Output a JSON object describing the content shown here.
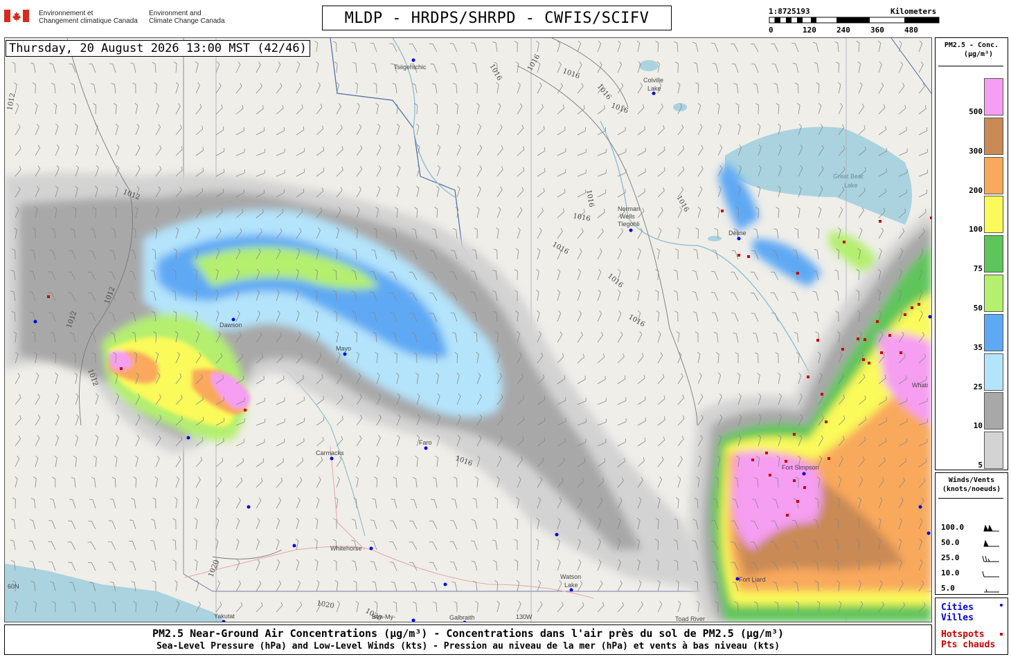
{
  "header": {
    "agency_fr": [
      "Environnement et",
      "Changement climatique Canada"
    ],
    "agency_en": [
      "Environment and",
      "Climate Change Canada"
    ],
    "title": "MLDP - HRDPS/SHRPD - CWFIS/SCIFV"
  },
  "scale_bar": {
    "ratio": "1:8725193",
    "unit": "Kilometers",
    "ticks": [
      "0",
      "120",
      "240",
      "360",
      "480"
    ]
  },
  "timestamp": "Thursday, 20 August 2026 13:00 MST (42/46)",
  "pm25_legend": {
    "title": [
      "PM2.5 - Conc.",
      "(µg/m³)"
    ],
    "classes": [
      {
        "label": "500",
        "color": "#f59ef2"
      },
      {
        "label": "300",
        "color": "#c98a55"
      },
      {
        "label": "200",
        "color": "#f9a95b"
      },
      {
        "label": "100",
        "color": "#fafa5a"
      },
      {
        "label": "75",
        "color": "#5ec55a"
      },
      {
        "label": "50",
        "color": "#b4ef6e"
      },
      {
        "label": "35",
        "color": "#5ea9f4"
      },
      {
        "label": "25",
        "color": "#b4e4fb"
      },
      {
        "label": "10",
        "color": "#a8a8a8"
      },
      {
        "label": "5",
        "color": "#d3d3d3"
      }
    ]
  },
  "wind_legend": {
    "title": [
      "Winds/Vents",
      "(knots/noeuds)"
    ],
    "rows": [
      "100.0",
      "50.0",
      "25.0",
      "10.0",
      "5.0"
    ]
  },
  "points_legend": {
    "cities": [
      "Cities",
      "Villes"
    ],
    "hotspots": [
      "Hotspots",
      "Pts chauds"
    ],
    "city_color": "#0000ee",
    "hotspot_color": "#cc0000"
  },
  "footer": {
    "line1": "PM2.5 Near-Ground Air Concentrations (µg/m³) - Concentrations dans l'air près du sol de PM2.5 (µg/m³)",
    "line2": "Sea-Level Pressure (hPa) and Low-Level Winds (kts) - Pression au niveau de la mer (hPa) et vents à bas niveau (kts)"
  },
  "map": {
    "places": [
      {
        "name": "Tsiigehtchic"
      },
      {
        "name": "Colville"
      },
      {
        "name": "Lake"
      },
      {
        "name": "Norman"
      },
      {
        "name": "Wells"
      },
      {
        "name": "Tlegohli"
      },
      {
        "name": "Déline"
      },
      {
        "name": "Great Bear"
      },
      {
        "name": "Lake"
      },
      {
        "name": "Dawson"
      },
      {
        "name": "Mayo"
      },
      {
        "name": "Faro"
      },
      {
        "name": "Carmacks"
      },
      {
        "name": "Whitehorse"
      },
      {
        "name": "Watson"
      },
      {
        "name": "Lake"
      },
      {
        "name": "Fort Simpson"
      },
      {
        "name": "Fort Liard"
      },
      {
        "name": "Whati"
      },
      {
        "name": "Yakutat"
      },
      {
        "name": "Galbraith"
      },
      {
        "name": "Toad River"
      },
      {
        "name": "Ben-My-"
      },
      {
        "name": "130W"
      },
      {
        "name": "60N"
      }
    ],
    "isobars": [
      "1016",
      "1016",
      "1016",
      "1016",
      "1016",
      "1016",
      "1016",
      "1016",
      "1016",
      "1016",
      "1016",
      "1016",
      "1012",
      "1012",
      "1012",
      "1012",
      "1012",
      "1020",
      "1020",
      "1020"
    ]
  }
}
